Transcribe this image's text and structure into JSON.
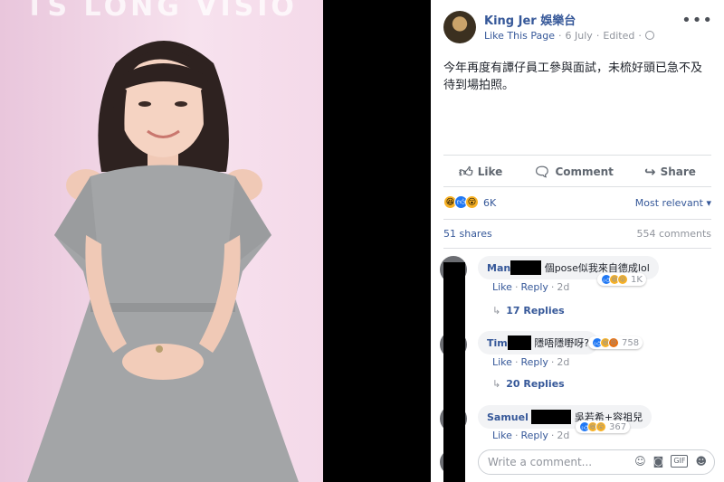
{
  "photo": {
    "banner_text": "TS LONG VISIO"
  },
  "post": {
    "page_name": "King Jer 娛樂台",
    "like_page": "Like This Page",
    "date": "6 July",
    "edited": "Edited",
    "text": "今年再度有譚仔員工參與面試，未梳好頭已急不及待到場拍照。",
    "actions": {
      "like": "Like",
      "comment": "Comment",
      "share": "Share"
    },
    "reaction_count": "6K",
    "sort_label": "Most relevant",
    "shares": "51 shares",
    "comments_count": "554 comments"
  },
  "comments": [
    {
      "name": "Man",
      "text": "個pose似我來自德成lol",
      "like": "Like",
      "reply": "Reply",
      "time": "2d",
      "reactions": "1K",
      "replies": "17 Replies"
    },
    {
      "name": "Tim",
      "text": "隱唔隱嘢呀?",
      "like": "Like",
      "reply": "Reply",
      "time": "2d",
      "reactions": "758",
      "replies": "20 Replies"
    },
    {
      "name": "Samuel",
      "text": "吳若希+容祖兒",
      "like": "Like",
      "reply": "Reply",
      "time": "2d",
      "reactions": "367"
    }
  ],
  "write_comment": {
    "placeholder": "Write a comment..."
  },
  "colors": {
    "link": "#365899",
    "meta": "#90949c",
    "like_blue": "#2078f4",
    "haha_yellow": "#f7b125"
  },
  "icons": [
    "globe-icon",
    "more-icon",
    "like-icon",
    "comment-icon",
    "share-icon",
    "reply-icon",
    "emoji-icon",
    "camera-icon",
    "gif-icon",
    "sticker-icon"
  ]
}
